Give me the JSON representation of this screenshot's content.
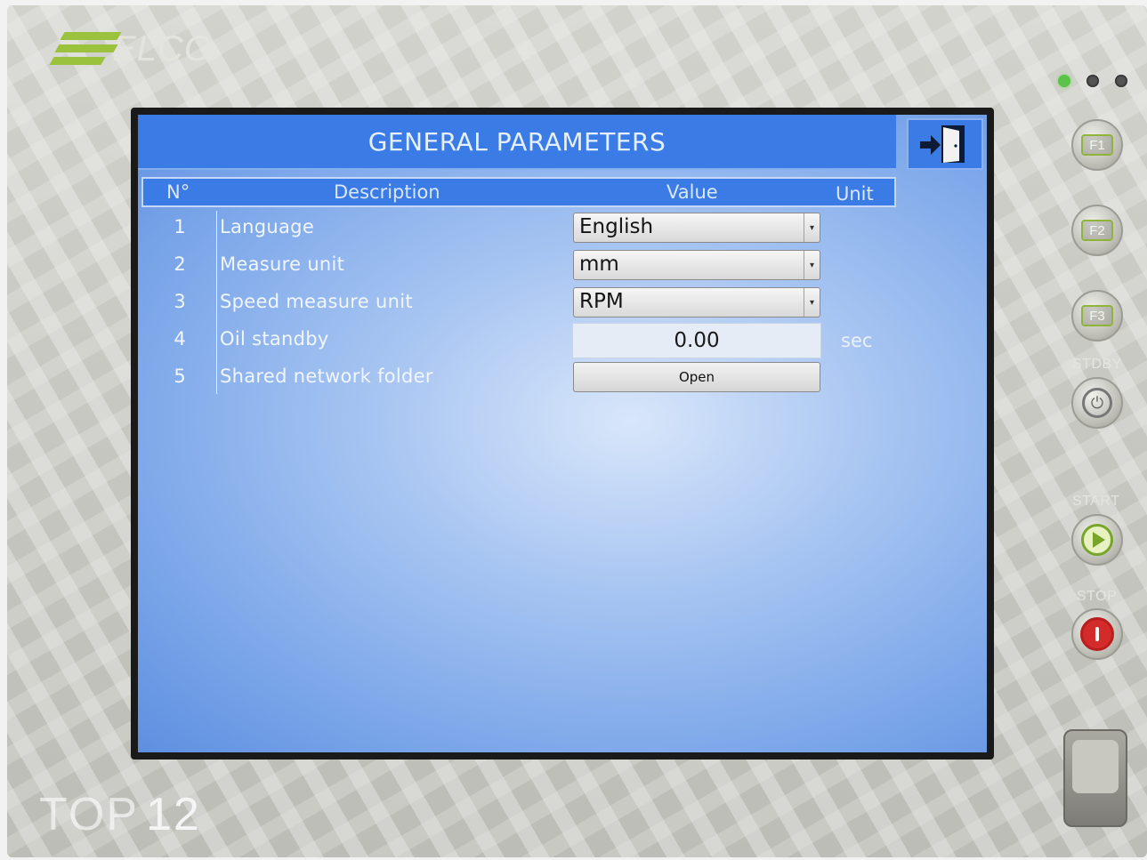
{
  "device": {
    "brand": "ELCO",
    "model_prefix": "TOP",
    "model_number": "12",
    "keys": {
      "f1": "F1",
      "f2": "F2",
      "f3": "F3",
      "standby": "STDBY",
      "start": "START",
      "stop": "STOP"
    },
    "leds": [
      "green",
      "off",
      "off"
    ]
  },
  "screen": {
    "title": "GENERAL PARAMETERS",
    "exit_icon": "exit-door-icon",
    "columns": {
      "number": "N°",
      "description": "Description",
      "value": "Value",
      "unit": "Unit"
    },
    "rows": [
      {
        "number": "1",
        "description": "Language",
        "type": "select",
        "value": "English",
        "unit": ""
      },
      {
        "number": "2",
        "description": "Measure unit",
        "type": "select",
        "value": "mm",
        "unit": ""
      },
      {
        "number": "3",
        "description": "Speed measure unit",
        "type": "select",
        "value": "RPM",
        "unit": ""
      },
      {
        "number": "4",
        "description": "Oil standby",
        "type": "numeric",
        "value": "0.00",
        "unit": "sec"
      },
      {
        "number": "5",
        "description": "Shared network folder",
        "type": "button",
        "value": "Open",
        "unit": ""
      }
    ]
  },
  "colors": {
    "title_bar": "#3a7be6",
    "screen_bg": "#a9c6f2",
    "accent_green": "#9ac23c",
    "stop_red": "#d32a2a"
  }
}
